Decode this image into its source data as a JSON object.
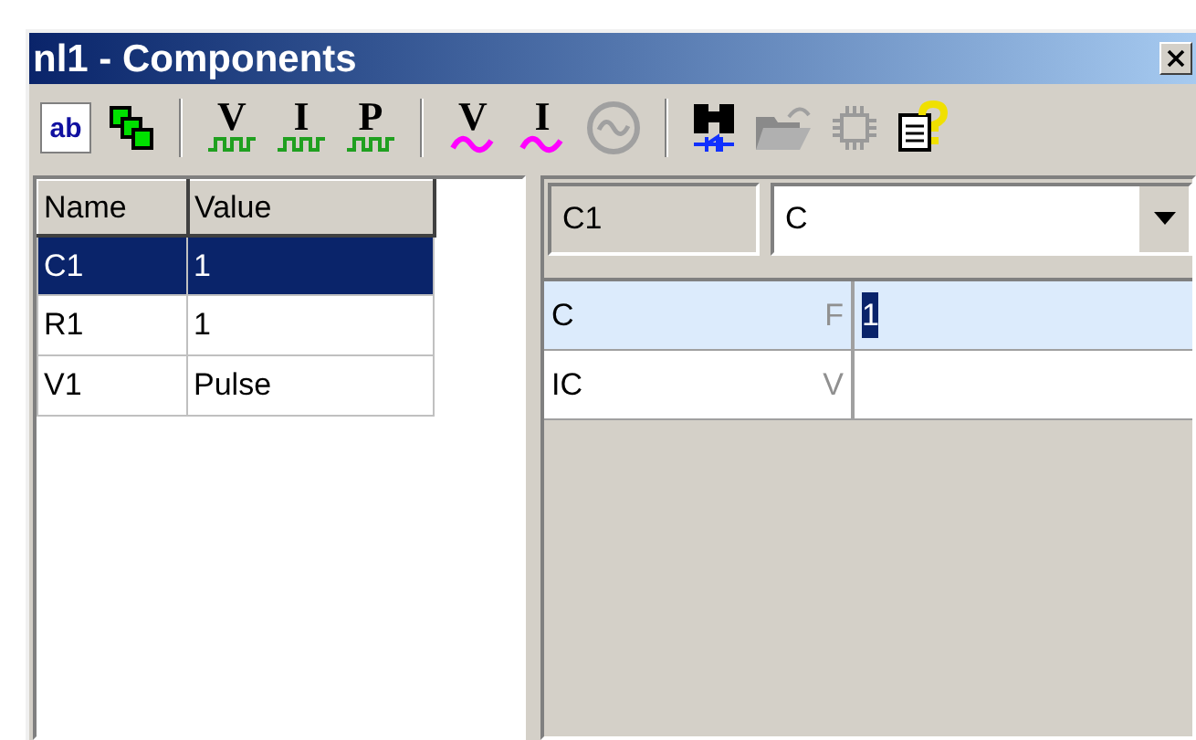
{
  "window": {
    "title": "nl1 - Components"
  },
  "toolbar": {
    "groups": [
      [
        {
          "kind": "text-edit",
          "label": "ab",
          "disabled": false
        },
        {
          "kind": "squares",
          "disabled": false
        }
      ],
      [
        {
          "kind": "pulse-source",
          "label": "V",
          "disabled": false
        },
        {
          "kind": "pulse-source",
          "label": "I",
          "disabled": false
        },
        {
          "kind": "pulse-source",
          "label": "P",
          "disabled": false
        }
      ],
      [
        {
          "kind": "sine-source",
          "label": "V",
          "disabled": false
        },
        {
          "kind": "sine-source",
          "label": "I",
          "disabled": false
        },
        {
          "kind": "sine-circle",
          "disabled": true
        }
      ],
      [
        {
          "kind": "binoculars",
          "disabled": false
        },
        {
          "kind": "folder",
          "disabled": true
        },
        {
          "kind": "chip",
          "disabled": true
        },
        {
          "kind": "help",
          "disabled": false
        }
      ]
    ]
  },
  "components": {
    "columns": [
      "Name",
      "Value"
    ],
    "rows": [
      {
        "name": "C1",
        "value": "1",
        "selected": true
      },
      {
        "name": "R1",
        "value": "1",
        "selected": false
      },
      {
        "name": "V1",
        "value": "Pulse",
        "selected": false
      }
    ]
  },
  "properties": {
    "component": "C1",
    "type": "C",
    "rows": [
      {
        "name": "C",
        "unit": "F",
        "value": "1",
        "selected": true
      },
      {
        "name": "IC",
        "unit": "V",
        "selected": false
      }
    ]
  }
}
